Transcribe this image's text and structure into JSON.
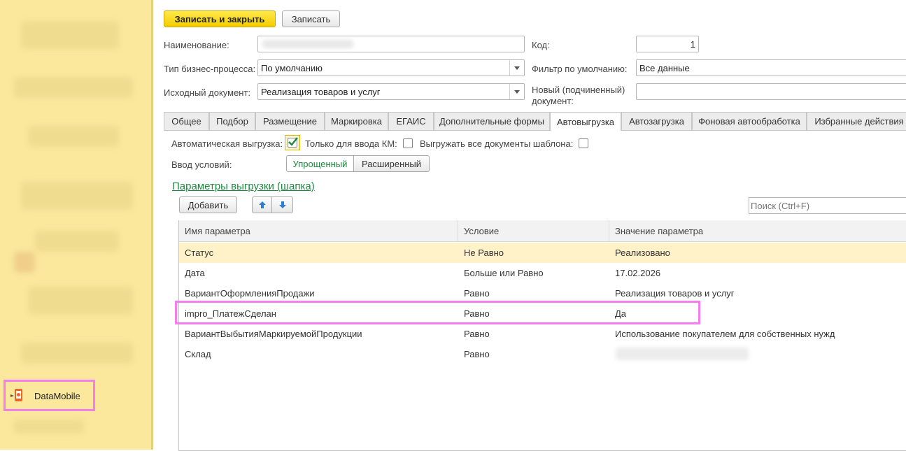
{
  "sidebar": {
    "app_label": "DataMobile"
  },
  "toolbar": {
    "save_close": "Записать и закрыть",
    "save": "Записать"
  },
  "form": {
    "name_label": "Наименование:",
    "name_value": "",
    "code_label": "Код:",
    "code_value": "1",
    "process_label": "Тип бизнес-процесса:",
    "process_value": "По умолчанию",
    "filter_label": "Фильтр по умолчанию:",
    "filter_value": "Все данные",
    "source_label": "Исходный документ:",
    "source_value": "Реализация товаров и услуг",
    "new_doc_label_1": "Новый (подчиненный)",
    "new_doc_label_2": "документ:",
    "new_doc_value": ""
  },
  "tabs": [
    "Общее",
    "Подбор",
    "Размещение",
    "Маркировка",
    "ЕГАИС",
    "Дополнительные формы",
    "Автовыгрузка",
    "Автозагрузка",
    "Фоновая автообработка",
    "Избранные действия"
  ],
  "active_tab": "Автовыгрузка",
  "autoexport": {
    "auto_label": "Автоматическая выгрузка:",
    "auto_checked": true,
    "km_label": "Только для ввода КМ:",
    "km_checked": false,
    "all_docs_label": "Выгружать все документы шаблона:",
    "all_docs_checked": false,
    "conditions_label": "Ввод условий:",
    "mode_simple": "Упрощенный",
    "mode_extended": "Расширенный",
    "section_link": "Параметры выгрузки (шапка)",
    "add_button": "Добавить",
    "search_placeholder": "Поиск (Ctrl+F)"
  },
  "table": {
    "columns": [
      "Имя параметра",
      "Условие",
      "Значение параметра"
    ],
    "rows": [
      {
        "name": "Статус",
        "condition": "Не Равно",
        "value": "Реализовано"
      },
      {
        "name": "Дата",
        "condition": "Больше или Равно",
        "value": "17.02.2026"
      },
      {
        "name": "ВариантОформленияПродажи",
        "condition": "Равно",
        "value": "Реализация товаров и услуг"
      },
      {
        "name": "impro_ПлатежСделан",
        "condition": "Равно",
        "value": "Да"
      },
      {
        "name": "ВариантВыбытияМаркируемойПродукции",
        "condition": "Равно",
        "value": "Использование покупателем для собственных нужд"
      },
      {
        "name": "Склад",
        "condition": "Равно",
        "value": ""
      }
    ]
  },
  "colors": {
    "highlight": "#f47ef0",
    "accent_green": "#1a8a3c",
    "selected_row": "#fff2c8",
    "sidebar": "#fbe89d"
  }
}
